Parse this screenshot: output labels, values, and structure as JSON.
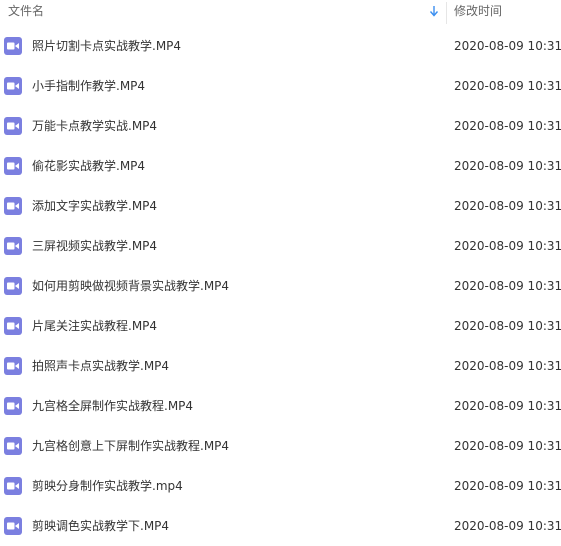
{
  "header": {
    "name_label": "文件名",
    "time_label": "修改时间",
    "sort_icon": "sort-down-arrow-icon"
  },
  "colors": {
    "icon_bg": "#7b7fe0",
    "sort_arrow": "#3b8ff0",
    "text": "#333333",
    "header_text": "#666666"
  },
  "files": [
    {
      "name": "照片切割卡点实战教学.MP4",
      "date": "2020-08-09 10:31",
      "icon": "video-file-icon"
    },
    {
      "name": "小手指制作教学.MP4",
      "date": "2020-08-09 10:31",
      "icon": "video-file-icon"
    },
    {
      "name": "万能卡点教学实战.MP4",
      "date": "2020-08-09 10:31",
      "icon": "video-file-icon"
    },
    {
      "name": "偷花影实战教学.MP4",
      "date": "2020-08-09 10:31",
      "icon": "video-file-icon"
    },
    {
      "name": "添加文字实战教学.MP4",
      "date": "2020-08-09 10:31",
      "icon": "video-file-icon"
    },
    {
      "name": "三屏视频实战教学.MP4",
      "date": "2020-08-09 10:31",
      "icon": "video-file-icon"
    },
    {
      "name": "如何用剪映做视频背景实战教学.MP4",
      "date": "2020-08-09 10:31",
      "icon": "video-file-icon"
    },
    {
      "name": "片尾关注实战教程.MP4",
      "date": "2020-08-09 10:31",
      "icon": "video-file-icon"
    },
    {
      "name": "拍照声卡点实战教学.MP4",
      "date": "2020-08-09 10:31",
      "icon": "video-file-icon"
    },
    {
      "name": "九宫格全屏制作实战教程.MP4",
      "date": "2020-08-09 10:31",
      "icon": "video-file-icon"
    },
    {
      "name": "九宫格创意上下屏制作实战教程.MP4",
      "date": "2020-08-09 10:31",
      "icon": "video-file-icon"
    },
    {
      "name": "剪映分身制作实战教学.mp4",
      "date": "2020-08-09 10:31",
      "icon": "video-file-icon"
    },
    {
      "name": "剪映调色实战教学下.MP4",
      "date": "2020-08-09 10:31",
      "icon": "video-file-icon"
    }
  ]
}
